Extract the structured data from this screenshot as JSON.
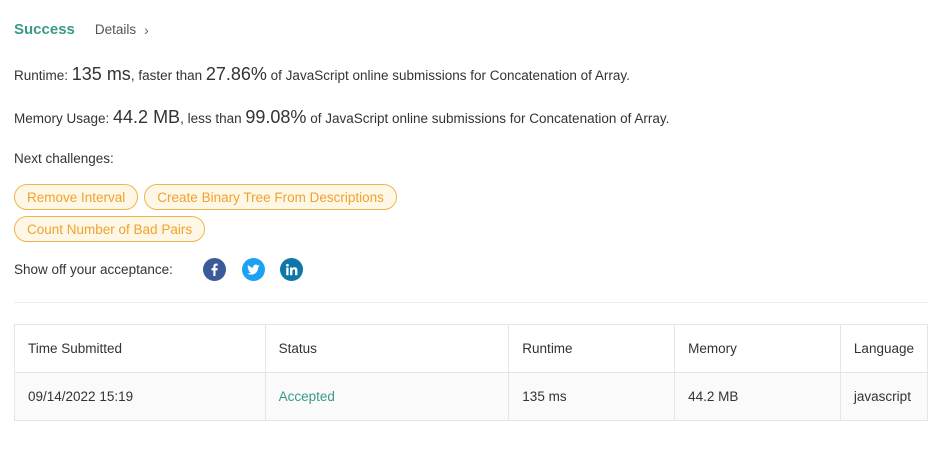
{
  "header": {
    "status": "Success",
    "details_label": "Details",
    "details_chevron": "›"
  },
  "runtime": {
    "label": "Runtime: ",
    "value": "135 ms",
    "comparison": ", faster than ",
    "percent": "27.86%",
    "suffix": " of JavaScript online submissions for Concatenation of Array."
  },
  "memory": {
    "label": "Memory Usage: ",
    "value": "44.2 MB",
    "comparison": ", less than ",
    "percent": "99.08%",
    "suffix": " of JavaScript online submissions for Concatenation of Array."
  },
  "next_challenges": {
    "label": "Next challenges:",
    "items": [
      "Remove Interval",
      "Create Binary Tree From Descriptions",
      "Count Number of Bad Pairs"
    ]
  },
  "share": {
    "label": "Show off your acceptance:",
    "icons": [
      "facebook-icon",
      "twitter-icon",
      "linkedin-icon"
    ]
  },
  "submissions": {
    "columns": [
      "Time Submitted",
      "Status",
      "Runtime",
      "Memory",
      "Language"
    ],
    "rows": [
      {
        "time": "09/14/2022 15:19",
        "status": "Accepted",
        "runtime": "135 ms",
        "memory": "44.2 MB",
        "language": "javascript"
      }
    ]
  },
  "colors": {
    "accent_green": "#3a9a8a",
    "chip_orange": "#f0a22e",
    "facebook": "#3b5a9a",
    "twitter": "#1da1f2",
    "linkedin": "#0e76a8"
  }
}
